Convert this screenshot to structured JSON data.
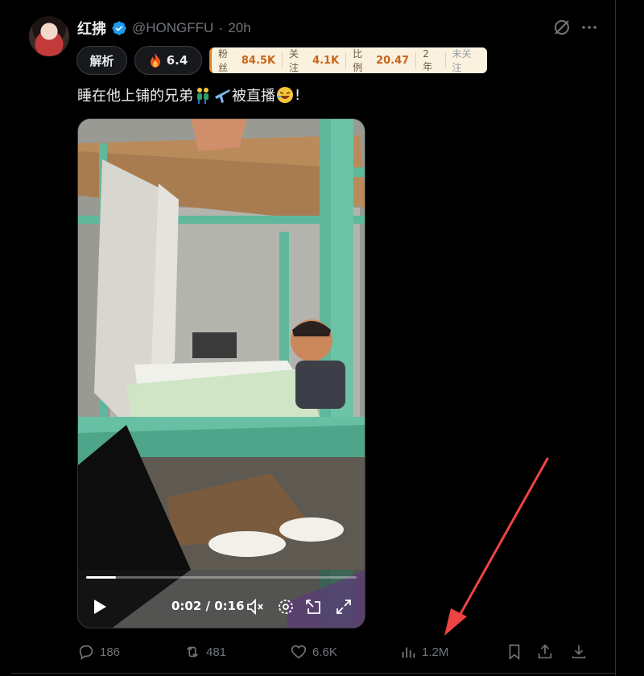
{
  "author": {
    "name": "红拂",
    "handle": "@HONGFFU",
    "separator": "·",
    "time_ago": "20h",
    "verified_icon": "verified-badge-icon"
  },
  "badges": {
    "analyze_label": "解析",
    "score_value": "6.4"
  },
  "stats": [
    {
      "key": "粉丝",
      "value": "84.5K"
    },
    {
      "key": "关注",
      "value": "4.1K"
    },
    {
      "key": "比例",
      "value": "20.47"
    },
    {
      "key": "2年",
      "value": ""
    },
    {
      "key": "未关注",
      "value": ""
    }
  ],
  "tweet": {
    "text_before": "睡在他上铺的兄弟",
    "text_after": "被直播",
    "text_end": "!"
  },
  "video": {
    "current_time": "0:02",
    "duration": "0:16",
    "time_display": "0:02 / 0:16",
    "progress_fraction": 0.11
  },
  "actions": {
    "replies": "186",
    "reposts": "481",
    "likes": "6.6K",
    "views": "1.2M"
  },
  "colors": {
    "background": "#000000",
    "text": "#e7e9ea",
    "muted": "#71767b",
    "verified": "#1d9bf0",
    "stat_value": "#c8641b",
    "annotation_arrow": "#ef4444"
  }
}
